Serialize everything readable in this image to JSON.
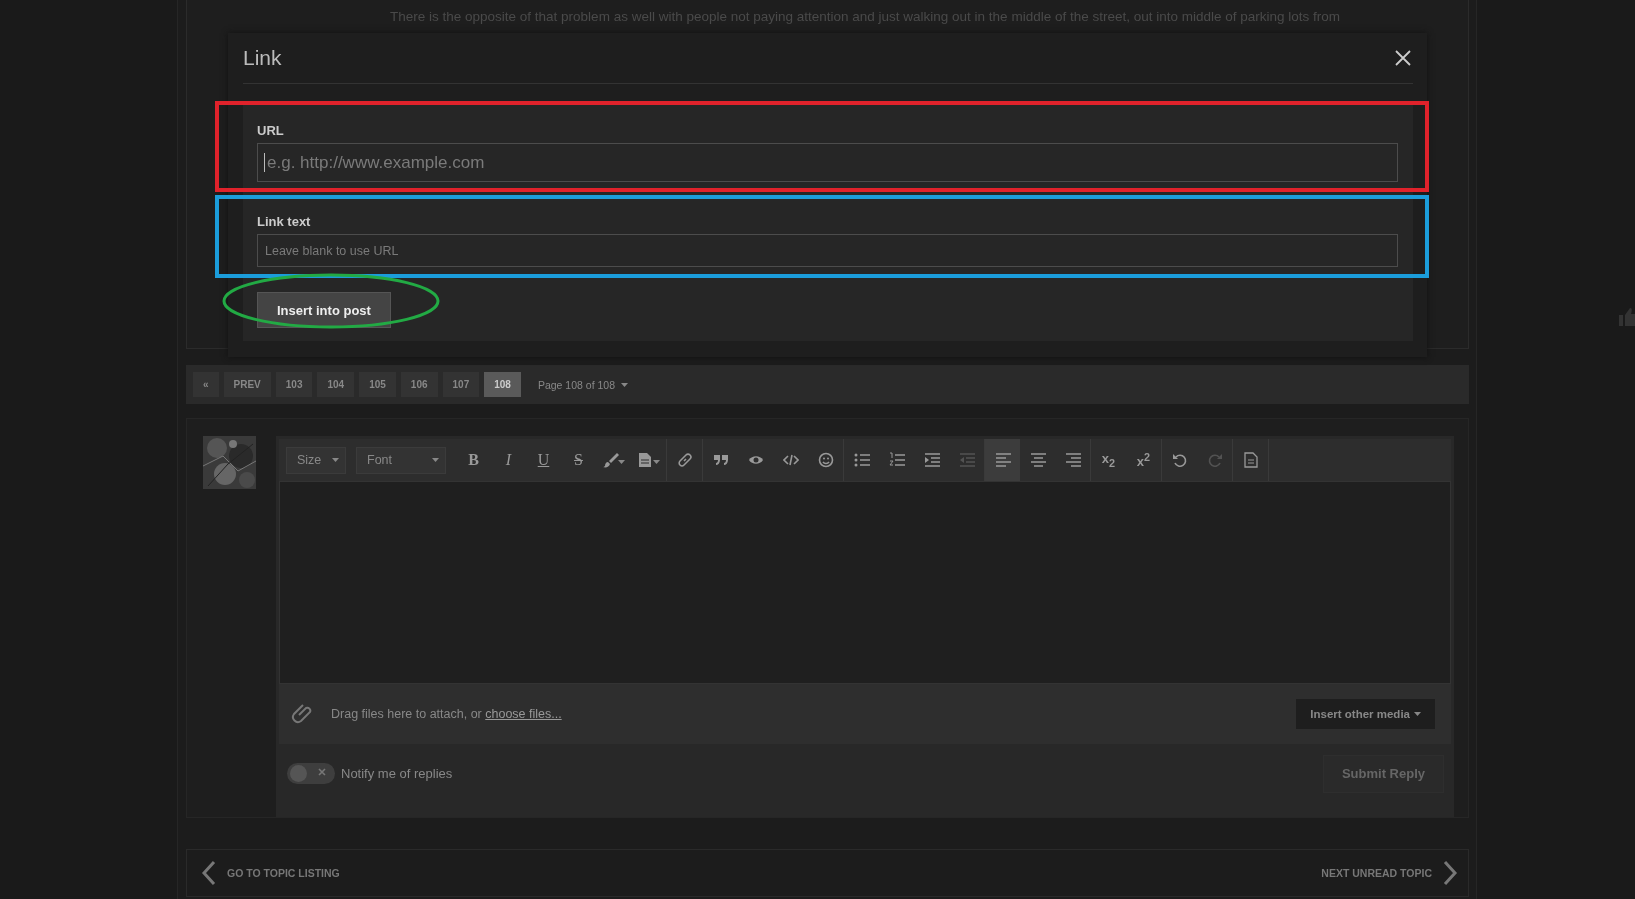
{
  "post": {
    "lines": [
      "There is the opposite of that problem as well with people not paying attention and just walking out in the middle of the street, out into middle of parking lots from"
    ]
  },
  "dialog": {
    "title": "Link",
    "fields": [
      {
        "label": "URL",
        "placeholder": "e.g. http://www.example.com",
        "kind": "large",
        "focused": true
      },
      {
        "label": "Link text",
        "placeholder": "Leave blank to use URL",
        "kind": "small",
        "focused": false
      }
    ],
    "button": {
      "label": "Insert into post"
    },
    "annotations": [
      {
        "kind": "rectangle",
        "color": "#e0222b"
      },
      {
        "kind": "rectangle",
        "color": "#1b9ddb"
      },
      {
        "kind": "ellipse",
        "color": "#22aa44"
      }
    ]
  },
  "pagination": {
    "pages": [
      {
        "label": "«",
        "selected": false
      },
      {
        "label": "PREV",
        "selected": false
      },
      {
        "label": "103",
        "selected": false
      },
      {
        "label": "104",
        "selected": false
      },
      {
        "label": "105",
        "selected": false
      },
      {
        "label": "106",
        "selected": false
      },
      {
        "label": "107",
        "selected": false
      },
      {
        "label": "108",
        "selected": true
      }
    ],
    "page_info": "Page 108 of 108"
  },
  "editor": {
    "toolbar": [
      [
        {
          "kind": "select",
          "label": "Size"
        }
      ],
      [
        {
          "kind": "select",
          "label": "Font"
        }
      ],
      [
        {
          "kind": "bold",
          "label": "B",
          "selected": false,
          "disabled": false
        },
        {
          "kind": "italic",
          "label": "I",
          "selected": false,
          "disabled": false
        },
        {
          "kind": "underline",
          "label": "U",
          "selected": false,
          "disabled": false
        },
        {
          "kind": "strike",
          "label": "S",
          "selected": false,
          "disabled": false
        },
        {
          "kind": "icon",
          "selected": false,
          "disabled": false
        },
        {
          "kind": "icon",
          "selected": false,
          "disabled": false
        }
      ],
      [
        {
          "kind": "icon",
          "selected": false,
          "disabled": false
        }
      ],
      [
        {
          "kind": "icon",
          "selected": false,
          "disabled": false
        },
        {
          "kind": "icon",
          "selected": false,
          "disabled": false
        },
        {
          "kind": "icon",
          "selected": false,
          "disabled": false
        },
        {
          "kind": "icon",
          "selected": false,
          "disabled": false
        }
      ],
      [
        {
          "kind": "icon",
          "selected": false,
          "disabled": false
        },
        {
          "kind": "icon",
          "selected": false,
          "disabled": false
        },
        {
          "kind": "icon",
          "selected": false,
          "disabled": false
        },
        {
          "kind": "icon",
          "selected": false,
          "disabled": true
        }
      ],
      [
        {
          "kind": "icon",
          "selected": true,
          "disabled": false
        },
        {
          "kind": "icon",
          "selected": false,
          "disabled": false
        },
        {
          "kind": "icon",
          "selected": false,
          "disabled": false
        }
      ],
      [
        {
          "kind": "script",
          "label": "x$_{2}$",
          "selected": false,
          "disabled": false
        },
        {
          "kind": "script",
          "label": "x$^{2}$",
          "selected": false,
          "disabled": false
        }
      ],
      [
        {
          "kind": "icon",
          "selected": false,
          "disabled": false
        },
        {
          "kind": "icon",
          "selected": false,
          "disabled": true
        }
      ],
      [
        {
          "kind": "icon",
          "selected": false,
          "disabled": false
        }
      ]
    ],
    "attach_text": "Drag files here to attach, or ",
    "attach_link": "choose files...",
    "media_button": "Insert other media",
    "notify": {
      "label": "Notify me of replies",
      "on": false
    },
    "submit": "Submit Reply"
  },
  "footer": {
    "back": "GO TO TOPIC LISTING",
    "next": "NEXT UNREAD TOPIC"
  }
}
